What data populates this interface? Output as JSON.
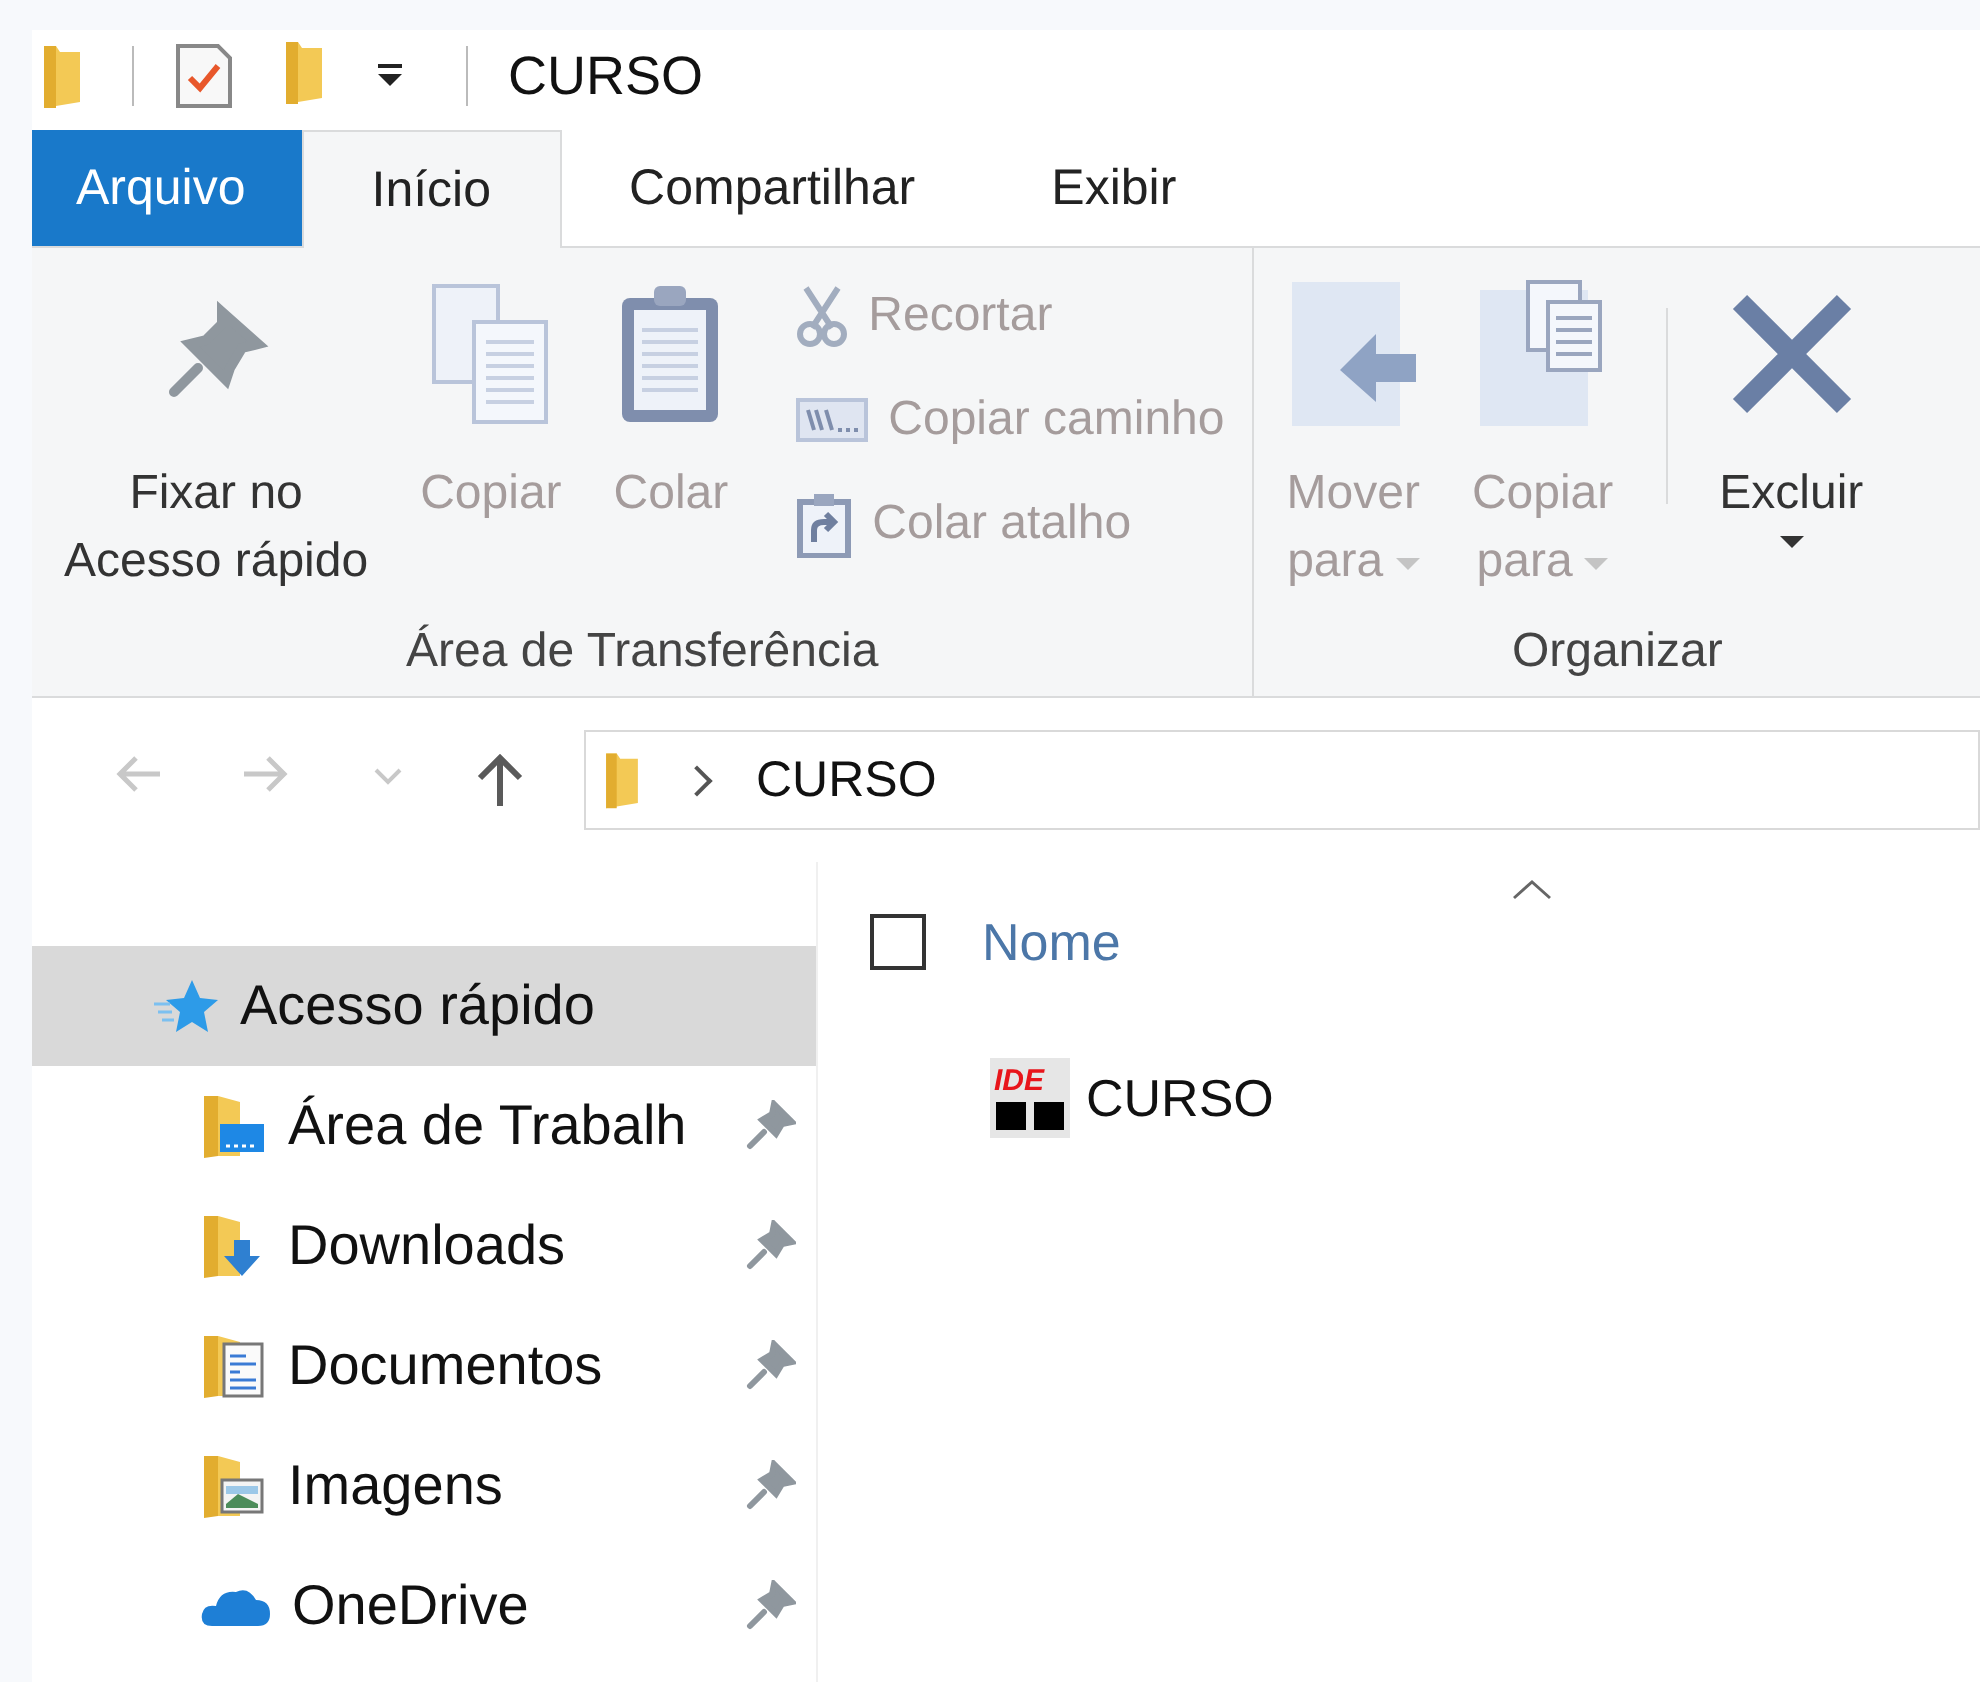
{
  "title_bar": {
    "title": "CURSO"
  },
  "tabs": [
    {
      "label": "Arquivo",
      "kind": "file",
      "selected": false
    },
    {
      "label": "Início",
      "kind": "tab",
      "selected": true
    },
    {
      "label": "Compartilhar",
      "kind": "tab",
      "selected": false
    },
    {
      "label": "Exibir",
      "kind": "tab",
      "selected": false
    }
  ],
  "ribbon": {
    "groups": [
      {
        "label": "Área de Transferência",
        "buttons": [
          {
            "kind": "pin",
            "lines": [
              "Fixar no",
              "Acesso rápido"
            ],
            "disabled": false
          },
          {
            "kind": "copy",
            "lines": [
              "Copiar"
            ],
            "disabled": true
          },
          {
            "kind": "paste",
            "lines": [
              "Colar"
            ],
            "disabled": true
          }
        ],
        "small_buttons": [
          {
            "kind": "scissors",
            "label": "Recortar",
            "disabled": true
          },
          {
            "kind": "path",
            "label": "Copiar caminho",
            "disabled": true
          },
          {
            "kind": "shortcut",
            "label": "Colar atalho",
            "disabled": true
          }
        ]
      },
      {
        "label": "Organizar",
        "buttons": [
          {
            "kind": "move",
            "lines": [
              "Mover",
              "para"
            ],
            "disabled": true,
            "dropdown": true
          },
          {
            "kind": "copyto",
            "lines": [
              "Copiar",
              "para"
            ],
            "disabled": true,
            "dropdown": true
          },
          {
            "kind": "delete",
            "lines": [
              "Excluir"
            ],
            "disabled": false,
            "dropdown": true
          }
        ]
      }
    ]
  },
  "navigation": {
    "buttons": [
      {
        "kind": "back",
        "disabled": true
      },
      {
        "kind": "forward",
        "disabled": true
      },
      {
        "kind": "recent",
        "disabled": true
      },
      {
        "kind": "up",
        "disabled": false
      }
    ],
    "address": {
      "segments": [
        "CURSO"
      ]
    }
  },
  "sidebar": {
    "items": [
      {
        "label": "Acesso rápido",
        "kind": "star",
        "selected": true,
        "children": [
          {
            "label": "Área de Trabalh",
            "kind": "desktop",
            "pinned": true,
            "selected": false
          },
          {
            "label": "Downloads",
            "kind": "downloads",
            "pinned": true,
            "selected": false
          },
          {
            "label": "Documentos",
            "kind": "documents",
            "pinned": true,
            "selected": false
          },
          {
            "label": "Imagens",
            "kind": "pictures",
            "pinned": true,
            "selected": false
          },
          {
            "label": "OneDrive",
            "kind": "cloud",
            "pinned": true,
            "selected": false
          }
        ]
      }
    ]
  },
  "file_list": {
    "columns": [
      {
        "label": "Nome",
        "sorted": true
      }
    ],
    "select_all_checked": false,
    "rows": [
      {
        "name": "CURSO",
        "icon_label": "IDE",
        "selected": false
      }
    ]
  }
}
